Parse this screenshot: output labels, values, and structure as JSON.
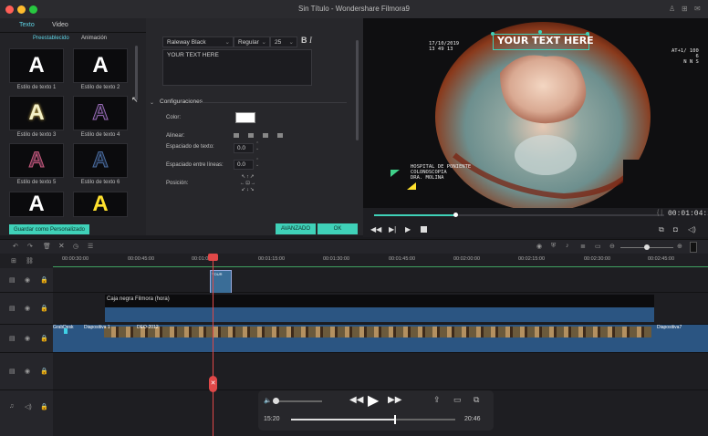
{
  "window": {
    "title": "Sin Título - Wondershare Filmora9"
  },
  "left": {
    "tabs": [
      "Texto",
      "Video"
    ],
    "subtabs": [
      "Preestablecido",
      "Animación"
    ],
    "presets": [
      {
        "glyph": "A",
        "label": "Estilo de texto 1",
        "color": "#ffffff"
      },
      {
        "glyph": "A",
        "label": "Estilo de texto 2",
        "color": "#ffffff"
      },
      {
        "glyph": "A",
        "label": "Estilo de texto 3",
        "color": "#f4f1c8"
      },
      {
        "glyph": "A",
        "label": "Estilo de texto 4",
        "color": "#3c3c55"
      },
      {
        "glyph": "A",
        "label": "Estilo de texto 5",
        "color": "#5a2d43"
      },
      {
        "glyph": "A",
        "label": "Estilo de texto 6",
        "color": "#23324a"
      },
      {
        "glyph": "A",
        "label": "",
        "color": "#ffffff"
      },
      {
        "glyph": "A",
        "label": "",
        "color": "#ffe12e"
      }
    ],
    "save_custom": "Guardar como Personalizado"
  },
  "editor": {
    "font": "Raleway Black",
    "weight": "Regular",
    "size": "25",
    "text_value": "YOUR TEXT HERE",
    "section": "Configuraciones",
    "color_label": "Color:",
    "align_label": "Alinear:",
    "spacing_label": "Espaciado de texto:",
    "spacing_value": "0.0",
    "line_spacing_label": "Espaciado entre líneas:",
    "line_spacing_value": "0.0",
    "position_label": "Posición:",
    "advanced": "AVANZADO",
    "ok": "OK"
  },
  "preview": {
    "overlay_text": "YOUR TEXT HERE",
    "date": "17/10/2019",
    "time": "13 49 13",
    "right_info": "AT+1/ 100\n6\nN N S",
    "hospital": "HOSPITAL DE PONIENTE\nCOLONOSCOPIA\nDRA. MOLINA",
    "timecode": "00:01:04:28",
    "progress": 0.28
  },
  "ruler": [
    "00:00:30:00",
    "00:00:45:00",
    "00:01:00:00",
    "00:01:15:00",
    "00:01:30:00",
    "00:01:45:00",
    "00:02:00:00",
    "00:02:15:00",
    "00:02:30:00",
    "00:02:45:00"
  ],
  "tracks": {
    "text_clip": "Caja negra Filmora (hora)",
    "small_clip": "YOUR",
    "video_labels": [
      "GrabDesk",
      "Diapositiva 1",
      "DEO-2012",
      "Diapositiva7"
    ]
  },
  "hud": {
    "start": "15:20",
    "end": "20:46",
    "progress": 0.63
  }
}
